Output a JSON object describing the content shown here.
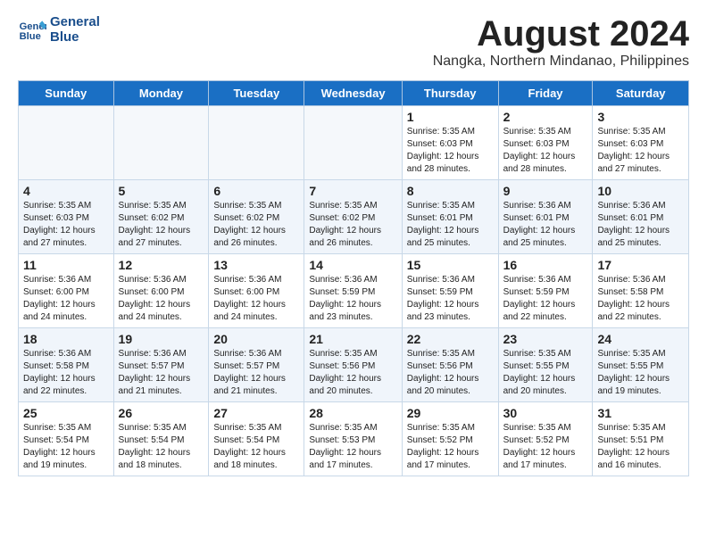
{
  "header": {
    "logo_line1": "General",
    "logo_line2": "Blue",
    "month_title": "August 2024",
    "location": "Nangka, Northern Mindanao, Philippines"
  },
  "days_of_week": [
    "Sunday",
    "Monday",
    "Tuesday",
    "Wednesday",
    "Thursday",
    "Friday",
    "Saturday"
  ],
  "weeks": [
    [
      {
        "day": "",
        "info": ""
      },
      {
        "day": "",
        "info": ""
      },
      {
        "day": "",
        "info": ""
      },
      {
        "day": "",
        "info": ""
      },
      {
        "day": "1",
        "info": "Sunrise: 5:35 AM\nSunset: 6:03 PM\nDaylight: 12 hours\nand 28 minutes."
      },
      {
        "day": "2",
        "info": "Sunrise: 5:35 AM\nSunset: 6:03 PM\nDaylight: 12 hours\nand 28 minutes."
      },
      {
        "day": "3",
        "info": "Sunrise: 5:35 AM\nSunset: 6:03 PM\nDaylight: 12 hours\nand 27 minutes."
      }
    ],
    [
      {
        "day": "4",
        "info": "Sunrise: 5:35 AM\nSunset: 6:03 PM\nDaylight: 12 hours\nand 27 minutes."
      },
      {
        "day": "5",
        "info": "Sunrise: 5:35 AM\nSunset: 6:02 PM\nDaylight: 12 hours\nand 27 minutes."
      },
      {
        "day": "6",
        "info": "Sunrise: 5:35 AM\nSunset: 6:02 PM\nDaylight: 12 hours\nand 26 minutes."
      },
      {
        "day": "7",
        "info": "Sunrise: 5:35 AM\nSunset: 6:02 PM\nDaylight: 12 hours\nand 26 minutes."
      },
      {
        "day": "8",
        "info": "Sunrise: 5:35 AM\nSunset: 6:01 PM\nDaylight: 12 hours\nand 25 minutes."
      },
      {
        "day": "9",
        "info": "Sunrise: 5:36 AM\nSunset: 6:01 PM\nDaylight: 12 hours\nand 25 minutes."
      },
      {
        "day": "10",
        "info": "Sunrise: 5:36 AM\nSunset: 6:01 PM\nDaylight: 12 hours\nand 25 minutes."
      }
    ],
    [
      {
        "day": "11",
        "info": "Sunrise: 5:36 AM\nSunset: 6:00 PM\nDaylight: 12 hours\nand 24 minutes."
      },
      {
        "day": "12",
        "info": "Sunrise: 5:36 AM\nSunset: 6:00 PM\nDaylight: 12 hours\nand 24 minutes."
      },
      {
        "day": "13",
        "info": "Sunrise: 5:36 AM\nSunset: 6:00 PM\nDaylight: 12 hours\nand 24 minutes."
      },
      {
        "day": "14",
        "info": "Sunrise: 5:36 AM\nSunset: 5:59 PM\nDaylight: 12 hours\nand 23 minutes."
      },
      {
        "day": "15",
        "info": "Sunrise: 5:36 AM\nSunset: 5:59 PM\nDaylight: 12 hours\nand 23 minutes."
      },
      {
        "day": "16",
        "info": "Sunrise: 5:36 AM\nSunset: 5:59 PM\nDaylight: 12 hours\nand 22 minutes."
      },
      {
        "day": "17",
        "info": "Sunrise: 5:36 AM\nSunset: 5:58 PM\nDaylight: 12 hours\nand 22 minutes."
      }
    ],
    [
      {
        "day": "18",
        "info": "Sunrise: 5:36 AM\nSunset: 5:58 PM\nDaylight: 12 hours\nand 22 minutes."
      },
      {
        "day": "19",
        "info": "Sunrise: 5:36 AM\nSunset: 5:57 PM\nDaylight: 12 hours\nand 21 minutes."
      },
      {
        "day": "20",
        "info": "Sunrise: 5:36 AM\nSunset: 5:57 PM\nDaylight: 12 hours\nand 21 minutes."
      },
      {
        "day": "21",
        "info": "Sunrise: 5:35 AM\nSunset: 5:56 PM\nDaylight: 12 hours\nand 20 minutes."
      },
      {
        "day": "22",
        "info": "Sunrise: 5:35 AM\nSunset: 5:56 PM\nDaylight: 12 hours\nand 20 minutes."
      },
      {
        "day": "23",
        "info": "Sunrise: 5:35 AM\nSunset: 5:55 PM\nDaylight: 12 hours\nand 20 minutes."
      },
      {
        "day": "24",
        "info": "Sunrise: 5:35 AM\nSunset: 5:55 PM\nDaylight: 12 hours\nand 19 minutes."
      }
    ],
    [
      {
        "day": "25",
        "info": "Sunrise: 5:35 AM\nSunset: 5:54 PM\nDaylight: 12 hours\nand 19 minutes."
      },
      {
        "day": "26",
        "info": "Sunrise: 5:35 AM\nSunset: 5:54 PM\nDaylight: 12 hours\nand 18 minutes."
      },
      {
        "day": "27",
        "info": "Sunrise: 5:35 AM\nSunset: 5:54 PM\nDaylight: 12 hours\nand 18 minutes."
      },
      {
        "day": "28",
        "info": "Sunrise: 5:35 AM\nSunset: 5:53 PM\nDaylight: 12 hours\nand 17 minutes."
      },
      {
        "day": "29",
        "info": "Sunrise: 5:35 AM\nSunset: 5:52 PM\nDaylight: 12 hours\nand 17 minutes."
      },
      {
        "day": "30",
        "info": "Sunrise: 5:35 AM\nSunset: 5:52 PM\nDaylight: 12 hours\nand 17 minutes."
      },
      {
        "day": "31",
        "info": "Sunrise: 5:35 AM\nSunset: 5:51 PM\nDaylight: 12 hours\nand 16 minutes."
      }
    ]
  ]
}
